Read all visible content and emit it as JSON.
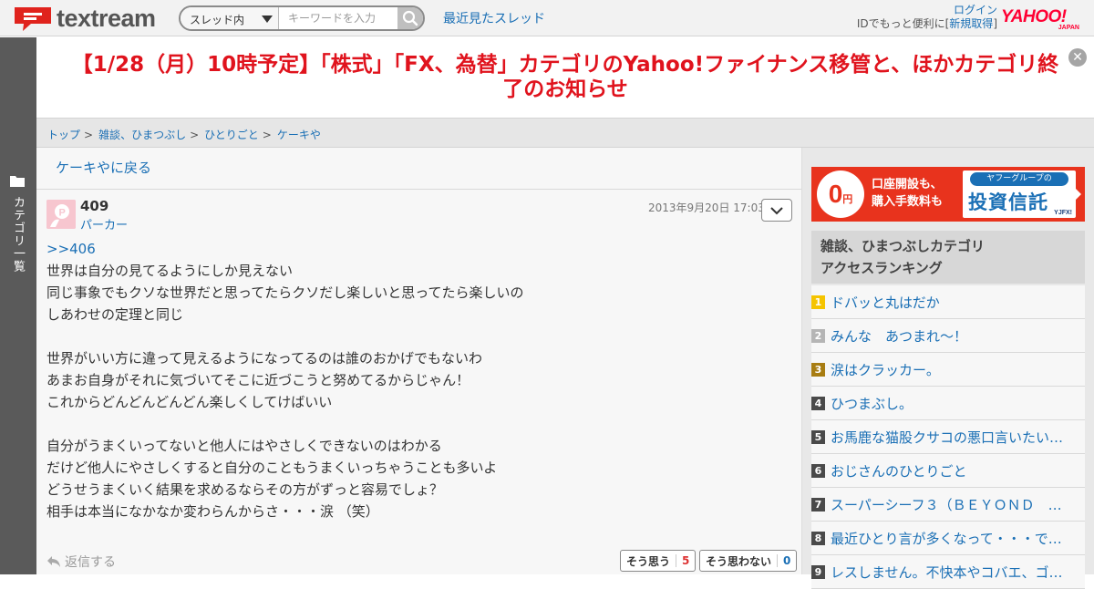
{
  "header": {
    "logo_text": "textream",
    "search_scope": "スレッド内",
    "search_placeholder": "キーワードを入力",
    "recent_link": "最近見たスレッド",
    "login_link": "ログイン",
    "id_prefix": "IDでもっと便利に[",
    "register_link": "新規取得",
    "id_suffix": "]",
    "yahoo_logo": "YAHOO!",
    "yahoo_sub": "JAPAN"
  },
  "left_bar": {
    "label": "カテゴリ一覧",
    "icon": "folder-icon"
  },
  "announcement": {
    "text": "【1/28（月）10時予定】「株式」「FX、為替」カテゴリのYahoo!ファイナンス移管と、ほかカテゴリ終了のお知らせ",
    "color": "#e0131d"
  },
  "breadcrumb": [
    {
      "label": "トップ"
    },
    {
      "label": "雑談、ひまつぶし"
    },
    {
      "label": "ひとりごと"
    },
    {
      "label": "ケーキや"
    }
  ],
  "breadcrumb_sep": ">",
  "back_link": "ケーキやに戻る",
  "post": {
    "number": "409",
    "user": "パーカー",
    "date": "2013年9月20日 17:03",
    "anchor": ">>406",
    "lines": [
      "世界は自分の見てるようにしか見えない",
      "同じ事象でもクソな世界だと思ってたらクソだし楽しいと思ってたら楽しいの",
      "しあわせの定理と同じ",
      "",
      "世界がいい方に違って見えるようになってるのは誰のおかげでもないわ",
      "あまお自身がそれに気づいてそこに近づこうと努めてるからじゃん！",
      "これからどんどんどんどん楽しくしてけばいい",
      "",
      "自分がうまくいってないと他人にはやさしくできないのはわかる",
      "だけど他人にやさしくすると自分のこともうまくいっちゃうことも多いよ",
      "どうせうまくいく結果を求めるならその方がずっと容易でしょ？",
      "相手は本当になかなか変わらんからさ・・・涙 （笑）"
    ],
    "reply_label": "返信する",
    "vote_yes_label": "そう思う",
    "vote_yes_count": "5",
    "vote_no_label": "そう思わない",
    "vote_no_count": "0"
  },
  "ad": {
    "zero": "0",
    "yen": "円",
    "line1": "口座開設も、",
    "line2": "購入手数料も",
    "tag": "ヤフーグループの",
    "big": "投資信託",
    "brand": "YJFX!"
  },
  "ranking": {
    "title_line1": "雑談、ひまつぶしカテゴリ",
    "title_line2": "アクセスランキング",
    "items": [
      {
        "rank": "1",
        "title": "ドバッと丸はだか",
        "color": "#f5c400"
      },
      {
        "rank": "2",
        "title": "みんな　あつまれ～！",
        "color": "#b5b5b5"
      },
      {
        "rank": "3",
        "title": "涙はクラッカー。",
        "color": "#a87d12"
      },
      {
        "rank": "4",
        "title": "ひつまぶし。",
        "color": "#4a4a4a"
      },
      {
        "rank": "5",
        "title": "お馬鹿な猫股クサコの悪口言いたい…",
        "color": "#4a4a4a"
      },
      {
        "rank": "6",
        "title": "おじさんのひとりごと",
        "color": "#4a4a4a"
      },
      {
        "rank": "7",
        "title": "スーパーシーフ３（ＢＥＹＯＮＤ　…",
        "color": "#4a4a4a"
      },
      {
        "rank": "8",
        "title": "最近ひとり言が多くなって・・・で…",
        "color": "#4a4a4a"
      },
      {
        "rank": "9",
        "title": "レスしません。不快本やコバエ、ゴ…",
        "color": "#4a4a4a"
      }
    ]
  }
}
